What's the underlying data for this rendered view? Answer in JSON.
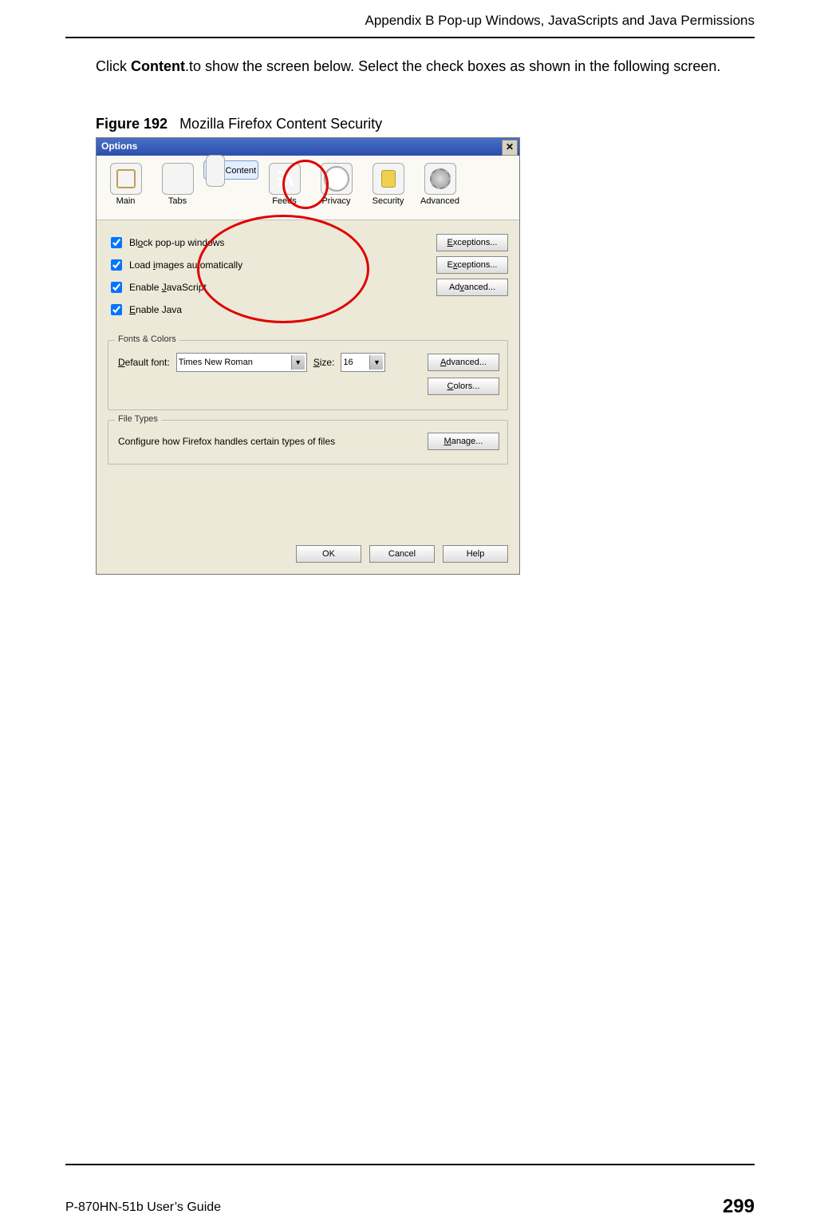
{
  "header": {
    "appendix": "Appendix B Pop-up Windows, JavaScripts and Java Permissions"
  },
  "body": {
    "intro_pre": "Click ",
    "intro_bold": "Content",
    "intro_post": ".to show the screen below. Select the check boxes as shown in the following screen."
  },
  "figcap": {
    "num": "Figure 192",
    "title": "Mozilla Firefox Content Security"
  },
  "dialog": {
    "title": "Options",
    "toolbar": [
      {
        "label": "Main",
        "icon": "ico-main"
      },
      {
        "label": "Tabs",
        "icon": "ico-tabs"
      },
      {
        "label": "Content",
        "icon": "ico-content",
        "selected": true
      },
      {
        "label": "Feeds",
        "icon": "ico-feeds"
      },
      {
        "label": "Privacy",
        "icon": "ico-privacy"
      },
      {
        "label": "Security",
        "icon": "ico-security"
      },
      {
        "label": "Advanced",
        "icon": "ico-advanced"
      }
    ],
    "checks": [
      {
        "label_pre": "Bl",
        "u": "o",
        "label_post": "ck pop-up windows",
        "button": "Exceptions..."
      },
      {
        "label_pre": "Load ",
        "u": "i",
        "label_post": "mages automatically",
        "button": "Exceptions..."
      },
      {
        "label_pre": "Enable ",
        "u": "J",
        "label_post": "avaScript",
        "button": "Advanced..."
      },
      {
        "label_pre": "",
        "u": "E",
        "label_post": "nable Java",
        "button": ""
      }
    ],
    "fonts": {
      "legend": "Fonts & Colors",
      "default_font_label_pre": "",
      "default_font_u": "D",
      "default_font_label_post": "efault font:",
      "font_value": "Times New Roman",
      "size_label_pre": "",
      "size_u": "S",
      "size_label_post": "ize:",
      "size_value": "16",
      "advanced": "Advanced...",
      "colors": "Colors...",
      "colors_u": "C",
      "colors_post": "olors..."
    },
    "filetypes": {
      "legend": "File Types",
      "desc": "Configure how Firefox handles certain types of files",
      "manage_u": "M",
      "manage_post": "anage..."
    },
    "footer": {
      "ok": "OK",
      "cancel": "Cancel",
      "help": "Help"
    }
  },
  "pagefooter": {
    "guide": "P-870HN-51b User’s Guide",
    "page": "299"
  }
}
